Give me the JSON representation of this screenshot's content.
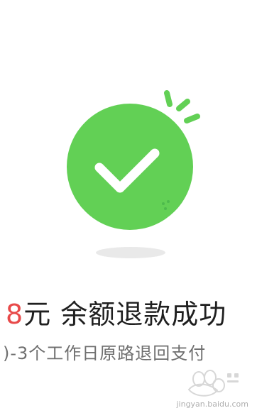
{
  "success": {
    "amount": "8",
    "message": "元 余额退款成功",
    "subtext": ")-3个工作日原路退回支付",
    "accent_color": "#62d055",
    "amount_color": "#e84a4a"
  },
  "icons": {
    "check": "checkmark-icon",
    "sparkle": "sparkle-icon"
  },
  "watermark": {
    "text": "jingyan.baidu.com"
  }
}
